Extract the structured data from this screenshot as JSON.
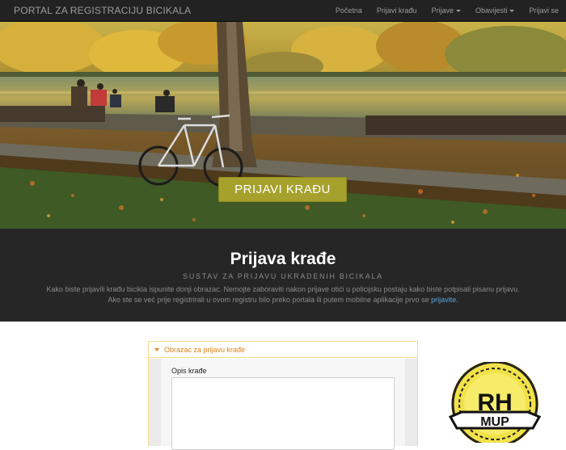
{
  "navbar": {
    "brand": "PORTAL ZA REGISTRACIJU BICIKALA",
    "items": [
      {
        "label": "Početna",
        "dropdown": false
      },
      {
        "label": "Prijavi krađu",
        "dropdown": false
      },
      {
        "label": "Prijave",
        "dropdown": true
      },
      {
        "label": "Obavijesti",
        "dropdown": true
      },
      {
        "label": "Prijavi se",
        "dropdown": false
      }
    ]
  },
  "hero": {
    "button_label": "PRIJAVI KRAĐU"
  },
  "info": {
    "title": "Prijava krađe",
    "subtitle": "SUSTAV ZA PRIJAVU UKRADENIH BICIKALA",
    "line1": "Kako biste prijavili krađu bicikla ispunite donji obrazac. Nemojte zaboraviti nakon prijave otići u policijsku postaju kako biste potpisali pisanu prijavu.",
    "line2_prefix": "Ako ste se već prije registrirali u ovom registru bilo preko portala ili putem mobilne aplikacije prvo se ",
    "line2_link": "prijavite",
    "line2_suffix": "."
  },
  "form": {
    "panel_title": "Obrazac za prijavu krađe",
    "description_label": "Opis krađe",
    "description_value": ""
  },
  "badge": {
    "text_top": "RH",
    "text_bottom": "MUP"
  },
  "colors": {
    "navbar_bg": "#222222",
    "hero_button": "#a6a12c",
    "info_bg": "#262626",
    "link": "#5aa6dc",
    "panel_accent": "#d9831a"
  }
}
